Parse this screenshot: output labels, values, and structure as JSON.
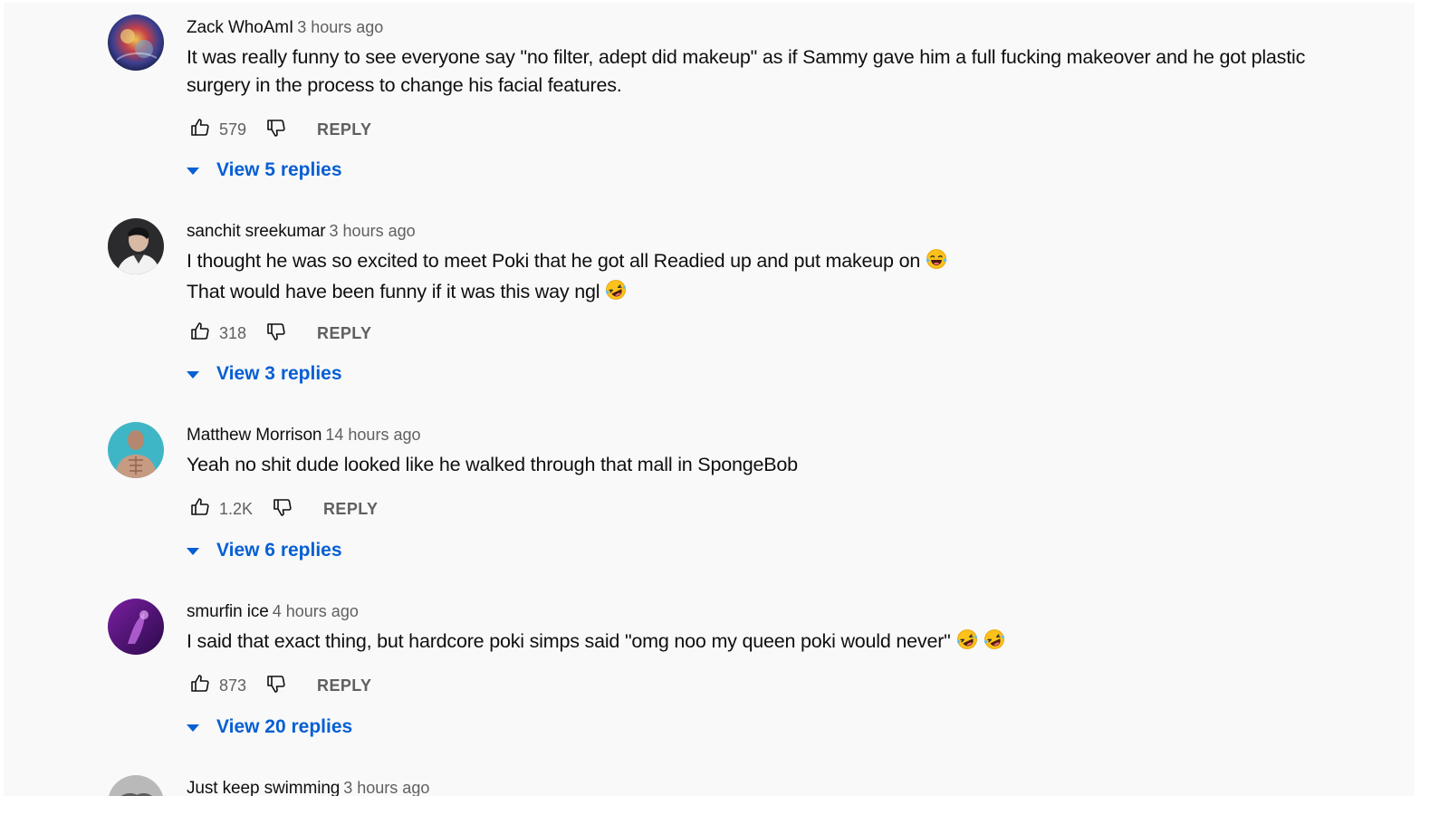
{
  "comments": [
    {
      "author": "Zack WhoAmI",
      "time": "3 hours ago",
      "lines": [
        "It was really funny to see everyone say \"no filter, adept did makeup\" as if Sammy gave him a full fucking makeover and he got plastic",
        "surgery in the process to change his facial features."
      ],
      "likes": "579",
      "reply_label": "REPLY",
      "view_replies": "View 5 replies",
      "avatar_icon": "galaxy-avatar"
    },
    {
      "author": "sanchit sreekumar",
      "time": "3 hours ago",
      "lines": [
        "I thought he was so excited to meet Poki that he got all Readied up and put makeup on",
        "That would have been funny if it was this way ngl"
      ],
      "likes": "318",
      "reply_label": "REPLY",
      "view_replies": "View 3 replies",
      "emojis": [
        "tears-of-joy-emoji",
        "rofl-emoji"
      ],
      "avatar_icon": "person-avatar"
    },
    {
      "author": "Matthew Morrison",
      "time": "14 hours ago",
      "lines": [
        "Yeah no shit dude looked like he walked through that mall in SpongeBob"
      ],
      "likes": "1.2K",
      "reply_label": "REPLY",
      "view_replies": "View 6 replies",
      "avatar_icon": "muscle-avatar"
    },
    {
      "author": "smurfin ice",
      "time": "4 hours ago",
      "lines": [
        "I said that exact thing, but hardcore poki simps said \"omg noo my queen poki would never\""
      ],
      "likes": "873",
      "reply_label": "REPLY",
      "view_replies": "View 20 replies",
      "emojis": [
        "rofl-emoji",
        "rofl-emoji"
      ],
      "avatar_icon": "purple-avatar"
    },
    {
      "author": "Just keep swimming",
      "time": "3 hours ago",
      "avatar_icon": "grey-avatar"
    }
  ],
  "colors": {
    "link_blue": "#065fd4",
    "meta_grey": "#606060",
    "text": "#0f0f0f",
    "background": "#f9f9f9"
  }
}
